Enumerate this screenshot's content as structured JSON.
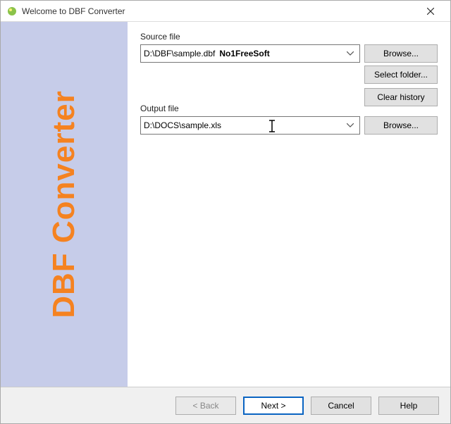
{
  "titlebar": {
    "title": "Welcome to DBF Converter"
  },
  "sidebar": {
    "text": "DBF Converter"
  },
  "source": {
    "label": "Source file",
    "value": "D:\\DBF\\sample.dbf",
    "watermark": "No1FreeSoft",
    "browse": "Browse...",
    "select_folder": "Select folder...",
    "clear_history": "Clear history"
  },
  "output": {
    "label": "Output file",
    "value": "D:\\DOCS\\sample.xls",
    "browse": "Browse..."
  },
  "footer": {
    "back": "< Back",
    "next": "Next >",
    "cancel": "Cancel",
    "help": "Help"
  }
}
